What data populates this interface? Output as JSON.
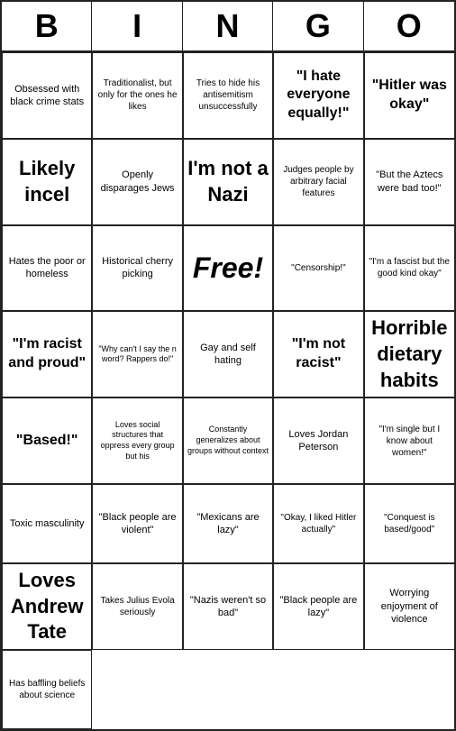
{
  "header": {
    "letters": [
      "B",
      "I",
      "N",
      "G",
      "O"
    ]
  },
  "cells": [
    {
      "text": "Obsessed with black crime stats",
      "size": "normal"
    },
    {
      "text": "Traditionalist, but only for the ones he likes",
      "size": "small"
    },
    {
      "text": "Tries to hide his antisemitism unsuccessfully",
      "size": "small"
    },
    {
      "text": "\"I hate everyone equally!\"",
      "size": "medium"
    },
    {
      "text": "\"Hitler was okay\"",
      "size": "medium"
    },
    {
      "text": "Likely incel",
      "size": "large"
    },
    {
      "text": "Openly disparages Jews",
      "size": "normal"
    },
    {
      "text": "I'm not a Nazi",
      "size": "large"
    },
    {
      "text": "Judges people by arbitrary facial features",
      "size": "small"
    },
    {
      "text": "\"But the Aztecs were bad too!\"",
      "size": "normal"
    },
    {
      "text": "Hates the poor or homeless",
      "size": "normal"
    },
    {
      "text": "Historical cherry picking",
      "size": "normal"
    },
    {
      "text": "Free!",
      "size": "free"
    },
    {
      "text": "\"Censorship!\"",
      "size": "small"
    },
    {
      "text": "\"I'm a fascist but the good kind okay\"",
      "size": "small"
    },
    {
      "text": "\"I'm racist and proud\"",
      "size": "medium"
    },
    {
      "text": "\"Why can't I say the n word? Rappers do!\"",
      "size": "xsmall"
    },
    {
      "text": "Gay and self hating",
      "size": "normal"
    },
    {
      "text": "\"I'm not racist\"",
      "size": "medium"
    },
    {
      "text": "Horrible dietary habits",
      "size": "large"
    },
    {
      "text": "\"Based!\"",
      "size": "medium"
    },
    {
      "text": "Loves social structures that oppress every group but his",
      "size": "xsmall"
    },
    {
      "text": "Constantly generalizes about groups without context",
      "size": "xsmall"
    },
    {
      "text": "Loves Jordan Peterson",
      "size": "normal"
    },
    {
      "text": "\"I'm single but I know about women!\"",
      "size": "small"
    },
    {
      "text": "Toxic masculinity",
      "size": "normal"
    },
    {
      "text": "\"Black people are violent\"",
      "size": "normal"
    },
    {
      "text": "\"Mexicans are lazy\"",
      "size": "normal"
    },
    {
      "text": "\"Okay, I liked Hitler actually\"",
      "size": "small"
    },
    {
      "text": "\"Conquest is based/good\"",
      "size": "small"
    },
    {
      "text": "Loves Andrew Tate",
      "size": "large"
    },
    {
      "text": "Takes Julius Evola seriously",
      "size": "small"
    },
    {
      "text": "\"Nazis weren't so bad\"",
      "size": "normal"
    },
    {
      "text": "\"Black people are lazy\"",
      "size": "normal"
    },
    {
      "text": "Worrying enjoyment of violence",
      "size": "normal"
    },
    {
      "text": "Has baffling beliefs about science",
      "size": "small"
    }
  ]
}
